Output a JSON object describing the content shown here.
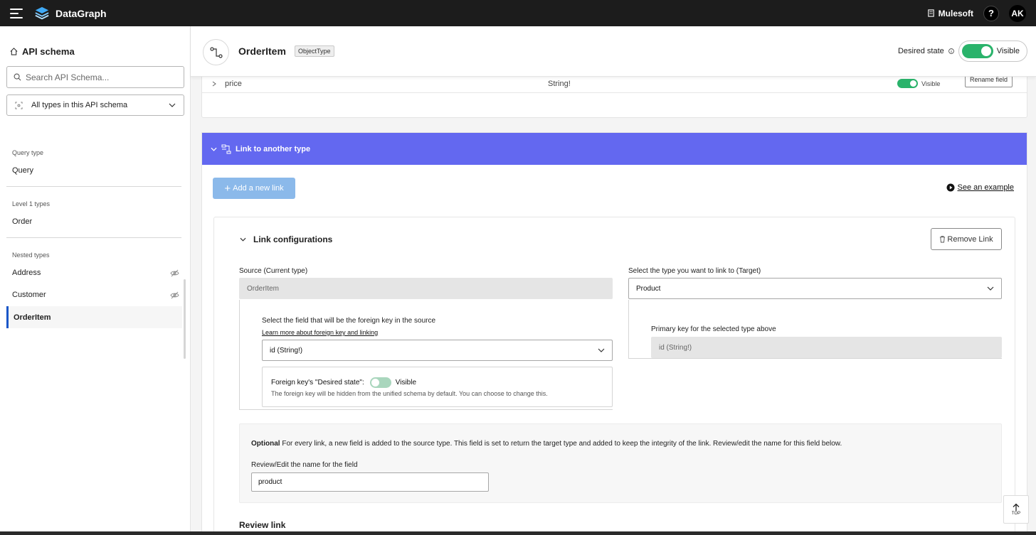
{
  "app": {
    "name": "DataGraph",
    "org": "Mulesoft",
    "help": "?",
    "user_initials": "AK"
  },
  "sidebar": {
    "title": "API schema",
    "search_placeholder": "Search API Schema...",
    "type_filter": "All types in this API schema",
    "sections": [
      {
        "label": "Query type",
        "items": [
          {
            "label": "Query"
          }
        ]
      },
      {
        "label": "Level 1 types",
        "items": [
          {
            "label": "Order"
          }
        ]
      },
      {
        "label": "Nested types",
        "items": [
          {
            "label": "Address",
            "hidden": true
          },
          {
            "label": "Customer",
            "hidden": true
          },
          {
            "label": "OrderItem",
            "active": true
          }
        ]
      }
    ]
  },
  "header": {
    "type_name": "OrderItem",
    "type_badge": "ObjectType",
    "desired_state_label": "Desired state",
    "visibility": "Visible"
  },
  "prev_field": {
    "name": "price",
    "type": "String!",
    "visibility": "Visible",
    "rename_label": "Rename field"
  },
  "link_panel": {
    "title": "Link to another type",
    "add_label": "Add a new link",
    "example_label": "See an example",
    "config": {
      "title": "Link configurations",
      "remove_label": "Remove Link",
      "source_label": "Source (Current type)",
      "source_value": "OrderItem",
      "target_label": "Select the type you want to link to (Target)",
      "target_value": "Product",
      "fk_label": "Select the field that will be the foreign key in the source",
      "fk_link": "Learn more about foreign key and linking",
      "fk_value": "id (String!)",
      "fk_state_label": "Foreign key's \"Desired state\":",
      "fk_state_value": "Visible",
      "fk_state_help": "The foreign key will be hidden from the unified schema by default. You can choose to change this.",
      "pk_label": "Primary key for the selected type above",
      "pk_value": "id (String!)",
      "optional_bold": "Optional",
      "optional_text": " For every link, a new field is added to the source type. This field is set to return the target type and added to keep the integrity of the link. Review/edit the name for this field below.",
      "field_name_label": "Review/Edit the name for the field",
      "field_name_value": "product",
      "review_title": "Review link"
    }
  },
  "top_button": "TOP",
  "colors": {
    "accent": "#6368f0",
    "toggle_on": "#2ab36b",
    "button_primary_disabled": "#8bb9ea"
  }
}
